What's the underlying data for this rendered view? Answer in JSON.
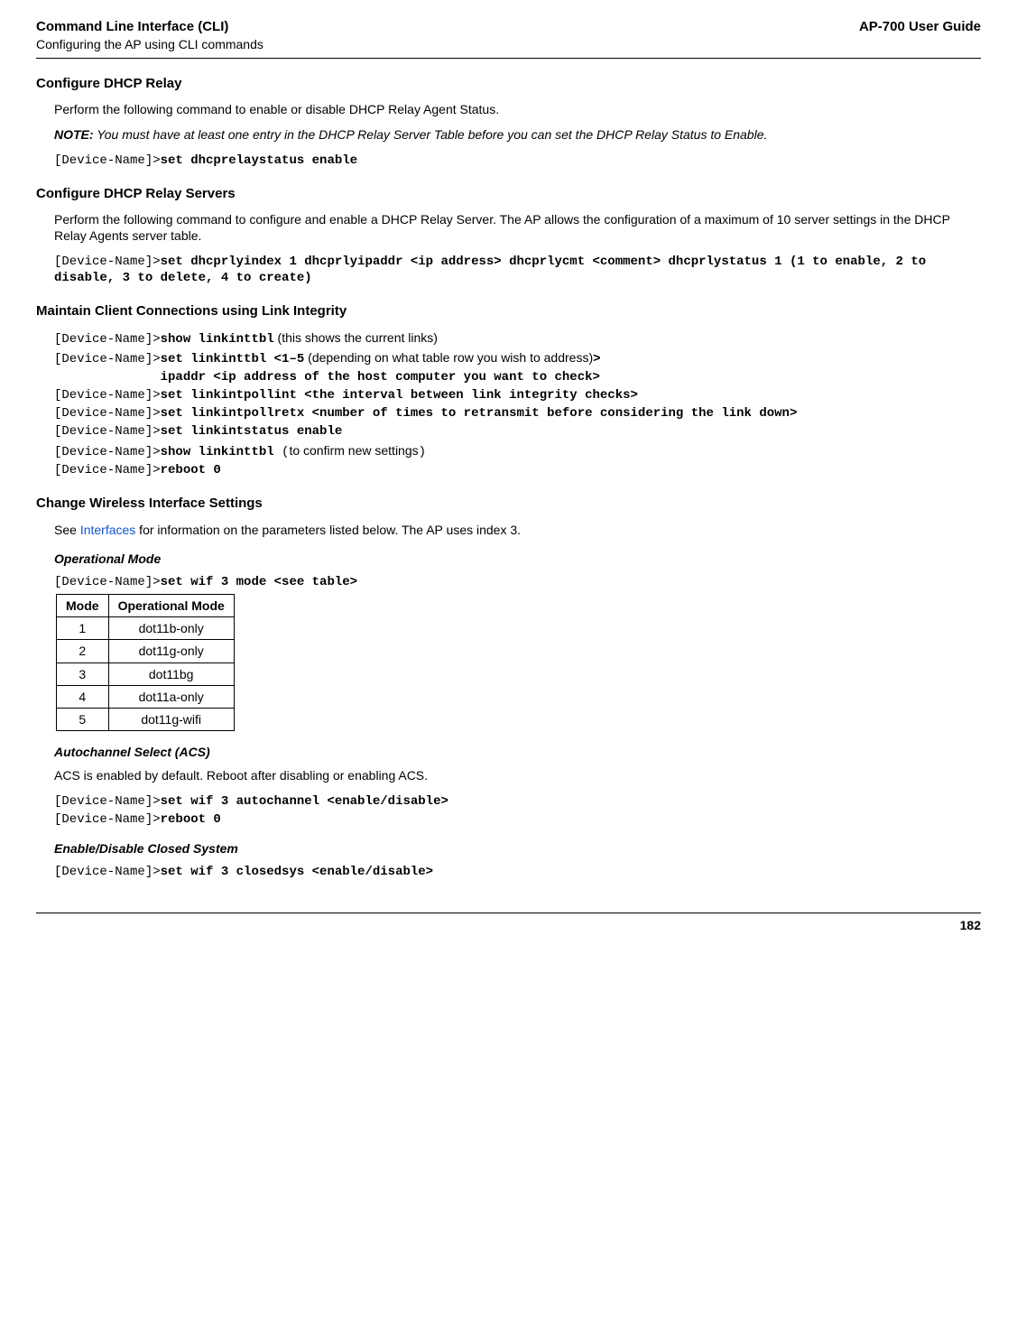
{
  "header": {
    "title": "Command Line Interface (CLI)",
    "subtitle": "Configuring the AP using CLI commands",
    "right": "AP-700 User Guide"
  },
  "sec1": {
    "heading": "Configure DHCP Relay",
    "p1": "Perform the following command to enable or disable DHCP Relay Agent Status.",
    "note_label": "NOTE:",
    "note_text": "You must have at least one entry in the DHCP Relay Server Table before you can set the DHCP Relay Status to Enable.",
    "prompt1": "[Device-Name]>",
    "cmd1": "set dhcprelaystatus enable"
  },
  "sec2": {
    "heading": "Configure DHCP Relay Servers",
    "p1": "Perform the following command to configure and enable a DHCP Relay Server. The AP allows the configuration of a maximum of 10 server settings in the DHCP Relay Agents server table.",
    "prompt1": "[Device-Name]>",
    "cmd1": "set dhcprlyindex 1 dhcprlyipaddr <ip address> dhcprlycmt <comment> dhcprlystatus 1 (1 to enable, 2 to disable, 3 to delete, 4 to create)"
  },
  "sec3": {
    "heading": "Maintain Client Connections using Link Integrity",
    "prompt": "[Device-Name]>",
    "cmd1": "show linkinttbl",
    "annot1": " (this shows the current links)",
    "cmd2": "set linkinttbl <1–5",
    "annot2": " (depending on what table row you wish to address)",
    "cmd2_tail": ">",
    "cmd2b": "              ipaddr <ip address of the host computer you want to check>",
    "cmd3": "set linkintpollint <the interval between link integrity checks>",
    "cmd4": "set linkintpollretx <number of times to retransmit before considering the link down>",
    "cmd5": "set linkintstatus enable",
    "cmd6": "show linkinttbl ",
    "annot6_open": "(",
    "annot6": "to confirm new settings",
    "annot6_close": ")",
    "cmd7": "reboot 0"
  },
  "sec4": {
    "heading": "Change Wireless Interface Settings",
    "p1_pre": "See ",
    "p1_link": "Interfaces",
    "p1_post": " for information on the parameters listed below. The AP uses index 3.",
    "sub1": "Operational Mode",
    "prompt1": "[Device-Name]>",
    "cmd1": "set wif 3 mode <see table>",
    "table": {
      "h1": "Mode",
      "h2": "Operational Mode",
      "rows": [
        {
          "mode": "1",
          "op": "dot11b-only"
        },
        {
          "mode": "2",
          "op": "dot11g-only"
        },
        {
          "mode": "3",
          "op": "dot11bg"
        },
        {
          "mode": "4",
          "op": "dot11a-only"
        },
        {
          "mode": "5",
          "op": "dot11g-wifi"
        }
      ]
    },
    "sub2": "Autochannel Select (ACS)",
    "p2": "ACS is enabled by default. Reboot after disabling or enabling ACS.",
    "prompt2": "[Device-Name]>",
    "cmd2": "set wif 3 autochannel <enable/disable>",
    "prompt3": "[Device-Name]>",
    "cmd3": "reboot 0",
    "sub3": "Enable/Disable Closed System",
    "prompt4": "[Device-Name]>",
    "cmd4": "set wif 3 closedsys <enable/disable>"
  },
  "footer": {
    "page": "182"
  },
  "chart_data": {
    "type": "table",
    "title": "Operational Mode",
    "columns": [
      "Mode",
      "Operational Mode"
    ],
    "rows": [
      [
        1,
        "dot11b-only"
      ],
      [
        2,
        "dot11g-only"
      ],
      [
        3,
        "dot11bg"
      ],
      [
        4,
        "dot11a-only"
      ],
      [
        5,
        "dot11g-wifi"
      ]
    ]
  }
}
